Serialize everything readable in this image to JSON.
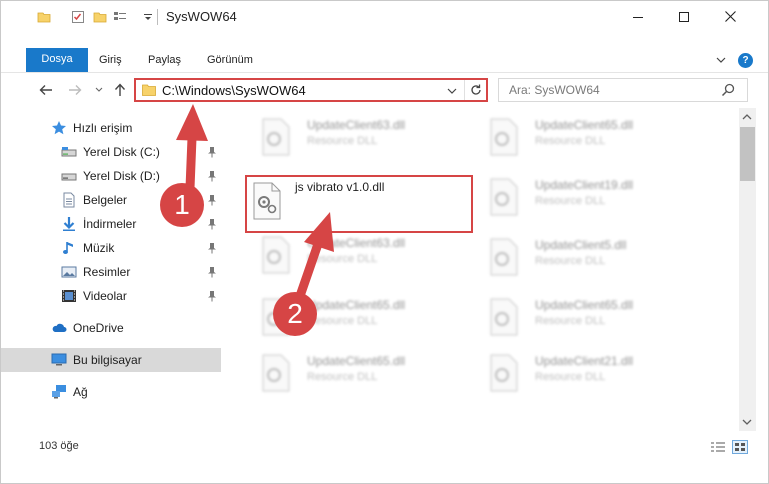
{
  "window": {
    "title": "SysWOW64"
  },
  "ribbon": {
    "tabs": [
      "Dosya",
      "Giriş",
      "Paylaş",
      "Görünüm"
    ],
    "help": "?"
  },
  "nav": {
    "address": "C:\\Windows\\SysWOW64",
    "search_placeholder": "Ara: SysWOW64"
  },
  "sidebar": {
    "items": [
      {
        "label": "Hızlı erişim",
        "icon": "star-icon"
      },
      {
        "label": "Yerel Disk (C:)",
        "icon": "drive-icon"
      },
      {
        "label": "Yerel Disk (D:)",
        "icon": "drive-icon"
      },
      {
        "label": "Belgeler",
        "icon": "documents-icon"
      },
      {
        "label": "İndirmeler",
        "icon": "download-icon"
      },
      {
        "label": "Müzik",
        "icon": "music-icon"
      },
      {
        "label": "Resimler",
        "icon": "pictures-icon"
      },
      {
        "label": "Videolar",
        "icon": "videos-icon"
      },
      {
        "label": "OneDrive",
        "icon": "cloud-icon"
      },
      {
        "label": "Bu bilgisayar",
        "icon": "computer-icon"
      },
      {
        "label": "Ağ",
        "icon": "network-icon"
      }
    ]
  },
  "files": {
    "left": [
      {
        "name": "UpdateClient63.dll",
        "type": "Resource DLL"
      },
      {
        "name": "UpdateClient63.dll",
        "type": "Resource DLL"
      },
      {
        "name": "UpdateClient65.dll",
        "type": "Resource DLL"
      },
      {
        "name": "UpdateClient65.dll",
        "type": "Resource DLL"
      }
    ],
    "right": [
      {
        "name": "UpdateClient65.dll",
        "type": "Resource DLL"
      },
      {
        "name": "UpdateClient19.dll",
        "type": "Resource DLL"
      },
      {
        "name": "UpdateClient5.dll",
        "type": "Resource DLL"
      },
      {
        "name": "UpdateClient65.dll",
        "type": "Resource DLL"
      },
      {
        "name": "UpdateClient21.dll",
        "type": "Resource DLL"
      }
    ],
    "highlighted": "js vibrato v1.0.dll"
  },
  "status": {
    "count": "103 öğe"
  },
  "annotations": {
    "step1": "1",
    "step2": "2"
  },
  "colors": {
    "accent": "#1979ca",
    "highlight": "#d64545"
  }
}
